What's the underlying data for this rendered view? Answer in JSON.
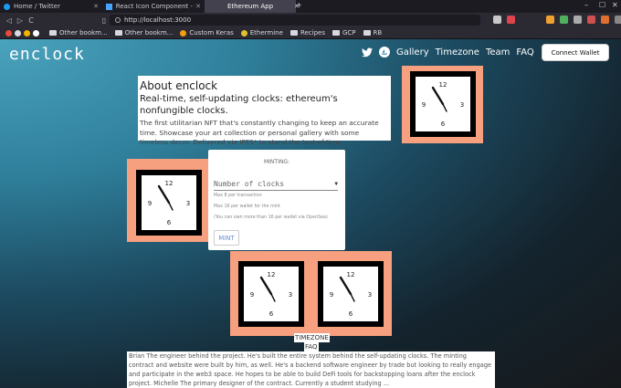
{
  "browser": {
    "tabs": [
      {
        "label": "Home / Twitter"
      },
      {
        "label": "React Icon Component - Mat…"
      },
      {
        "label": "Ethereum App"
      }
    ],
    "new_tab": "+",
    "url": "http://localhost:3000",
    "bookmarks": [
      "Other bookm...",
      "Other bookm...",
      "Custom Keras",
      "Ethermine",
      "Recipes",
      "GCP",
      "RB"
    ]
  },
  "site": {
    "logo": "enclock",
    "nav": {
      "gallery": "Gallery",
      "timezone": "Timezone",
      "team": "Team",
      "faq": "FAQ"
    },
    "connect_button": "Connect Wallet"
  },
  "about": {
    "title": "About enclock",
    "subtitle": "Real-time, self-updating clocks: ethereum's nonfungible clocks.",
    "body": "The first utilitarian NFT that's constantly changing to keep an accurate time. Showcase your art collection or personal gallery with some timeless decor. Delivered via IPFS* to stand the test of time."
  },
  "mint": {
    "title": "MINTING:",
    "select_placeholder": "Number of clocks",
    "hints": [
      "Max 8 per transaction",
      "Max 16 per wallet for the mint",
      "(You can own more than 16 per wallet via OpenSea)"
    ],
    "button": "MINT"
  },
  "clock": {
    "numerals": [
      "12",
      "3",
      "6",
      "9"
    ],
    "colors": {
      "card": "#f7a07f",
      "frame": "#000000",
      "face": "#ffffff"
    }
  },
  "sections": {
    "timezone": "TIMEZONE",
    "faq": "FAQ"
  },
  "team_bio": "Brian The engineer behind the project. He's built the entire system behind the self-updating clocks. The minting contract and website were built by him, as well. He's a backend software engineer by trade but looking to really engage and participate in the web3 space. He hopes to be able to build DeFi tools for backstopping loans after the enclock project. Michelle The primary designer of the contract. Currently a student studying ..."
}
